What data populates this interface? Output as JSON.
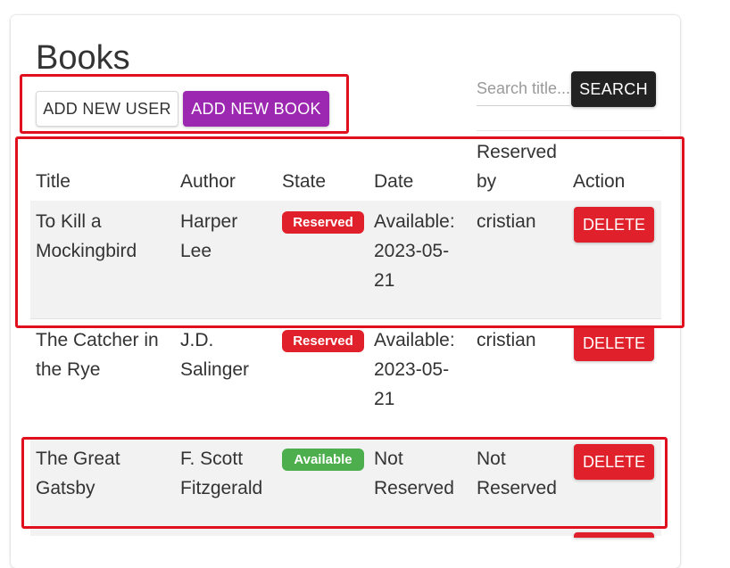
{
  "page": {
    "title": "Books"
  },
  "toolbar": {
    "add_user_label": "ADD NEW USER",
    "add_book_label": "ADD NEW BOOK"
  },
  "search": {
    "placeholder": "Search title...",
    "button_label": "SEARCH"
  },
  "table": {
    "headers": {
      "title": "Title",
      "author": "Author",
      "state": "State",
      "date": "Date",
      "reserved_by": "Reserved by",
      "action": "Action"
    },
    "rows": [
      {
        "title_l1": "To Kill a",
        "title_l2": "Mockingbird",
        "author_l1": "Harper",
        "author_l2": "Lee",
        "state": "Reserved",
        "date_l1": "Available:",
        "date_l2": "2023-05-",
        "date_l3": "21",
        "reserved_l1": "cristian",
        "reserved_l2": "",
        "action": "DELETE"
      },
      {
        "title_l1": "The Catcher in",
        "title_l2": "the Rye",
        "author_l1": "J.D.",
        "author_l2": "Salinger",
        "state": "Reserved",
        "date_l1": "Available:",
        "date_l2": "2023-05-",
        "date_l3": "21",
        "reserved_l1": "cristian",
        "reserved_l2": "",
        "action": "DELETE"
      },
      {
        "title_l1": "The Great",
        "title_l2": "Gatsby",
        "author_l1": "F. Scott",
        "author_l2": "Fitzgerald",
        "state": "Available",
        "date_l1": "Not",
        "date_l2": "Reserved",
        "date_l3": "",
        "reserved_l1": "Not",
        "reserved_l2": "Reserved",
        "action": "DELETE"
      }
    ]
  },
  "colors": {
    "accent_purple": "#9c27b0",
    "danger_red": "#e0202a",
    "success_green": "#4cae4c",
    "highlight_red": "#e0101e"
  }
}
